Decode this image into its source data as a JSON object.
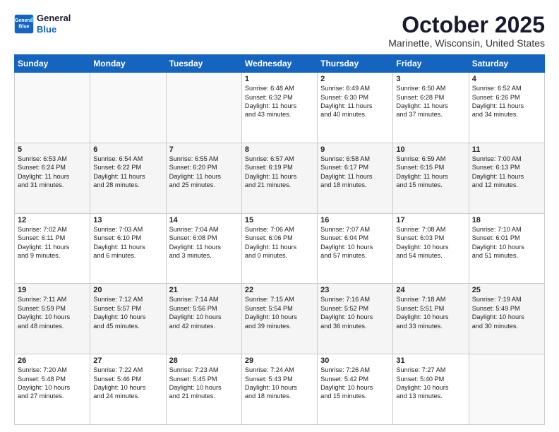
{
  "header": {
    "logo_line1": "General",
    "logo_line2": "Blue",
    "main_title": "October 2025",
    "subtitle": "Marinette, Wisconsin, United States"
  },
  "days_of_week": [
    "Sunday",
    "Monday",
    "Tuesday",
    "Wednesday",
    "Thursday",
    "Friday",
    "Saturday"
  ],
  "weeks": [
    [
      {
        "day": "",
        "info": ""
      },
      {
        "day": "",
        "info": ""
      },
      {
        "day": "",
        "info": ""
      },
      {
        "day": "1",
        "info": "Sunrise: 6:48 AM\nSunset: 6:32 PM\nDaylight: 11 hours\nand 43 minutes."
      },
      {
        "day": "2",
        "info": "Sunrise: 6:49 AM\nSunset: 6:30 PM\nDaylight: 11 hours\nand 40 minutes."
      },
      {
        "day": "3",
        "info": "Sunrise: 6:50 AM\nSunset: 6:28 PM\nDaylight: 11 hours\nand 37 minutes."
      },
      {
        "day": "4",
        "info": "Sunrise: 6:52 AM\nSunset: 6:26 PM\nDaylight: 11 hours\nand 34 minutes."
      }
    ],
    [
      {
        "day": "5",
        "info": "Sunrise: 6:53 AM\nSunset: 6:24 PM\nDaylight: 11 hours\nand 31 minutes."
      },
      {
        "day": "6",
        "info": "Sunrise: 6:54 AM\nSunset: 6:22 PM\nDaylight: 11 hours\nand 28 minutes."
      },
      {
        "day": "7",
        "info": "Sunrise: 6:55 AM\nSunset: 6:20 PM\nDaylight: 11 hours\nand 25 minutes."
      },
      {
        "day": "8",
        "info": "Sunrise: 6:57 AM\nSunset: 6:19 PM\nDaylight: 11 hours\nand 21 minutes."
      },
      {
        "day": "9",
        "info": "Sunrise: 6:58 AM\nSunset: 6:17 PM\nDaylight: 11 hours\nand 18 minutes."
      },
      {
        "day": "10",
        "info": "Sunrise: 6:59 AM\nSunset: 6:15 PM\nDaylight: 11 hours\nand 15 minutes."
      },
      {
        "day": "11",
        "info": "Sunrise: 7:00 AM\nSunset: 6:13 PM\nDaylight: 11 hours\nand 12 minutes."
      }
    ],
    [
      {
        "day": "12",
        "info": "Sunrise: 7:02 AM\nSunset: 6:11 PM\nDaylight: 11 hours\nand 9 minutes."
      },
      {
        "day": "13",
        "info": "Sunrise: 7:03 AM\nSunset: 6:10 PM\nDaylight: 11 hours\nand 6 minutes."
      },
      {
        "day": "14",
        "info": "Sunrise: 7:04 AM\nSunset: 6:08 PM\nDaylight: 11 hours\nand 3 minutes."
      },
      {
        "day": "15",
        "info": "Sunrise: 7:06 AM\nSunset: 6:06 PM\nDaylight: 11 hours\nand 0 minutes."
      },
      {
        "day": "16",
        "info": "Sunrise: 7:07 AM\nSunset: 6:04 PM\nDaylight: 10 hours\nand 57 minutes."
      },
      {
        "day": "17",
        "info": "Sunrise: 7:08 AM\nSunset: 6:03 PM\nDaylight: 10 hours\nand 54 minutes."
      },
      {
        "day": "18",
        "info": "Sunrise: 7:10 AM\nSunset: 6:01 PM\nDaylight: 10 hours\nand 51 minutes."
      }
    ],
    [
      {
        "day": "19",
        "info": "Sunrise: 7:11 AM\nSunset: 5:59 PM\nDaylight: 10 hours\nand 48 minutes."
      },
      {
        "day": "20",
        "info": "Sunrise: 7:12 AM\nSunset: 5:57 PM\nDaylight: 10 hours\nand 45 minutes."
      },
      {
        "day": "21",
        "info": "Sunrise: 7:14 AM\nSunset: 5:56 PM\nDaylight: 10 hours\nand 42 minutes."
      },
      {
        "day": "22",
        "info": "Sunrise: 7:15 AM\nSunset: 5:54 PM\nDaylight: 10 hours\nand 39 minutes."
      },
      {
        "day": "23",
        "info": "Sunrise: 7:16 AM\nSunset: 5:52 PM\nDaylight: 10 hours\nand 36 minutes."
      },
      {
        "day": "24",
        "info": "Sunrise: 7:18 AM\nSunset: 5:51 PM\nDaylight: 10 hours\nand 33 minutes."
      },
      {
        "day": "25",
        "info": "Sunrise: 7:19 AM\nSunset: 5:49 PM\nDaylight: 10 hours\nand 30 minutes."
      }
    ],
    [
      {
        "day": "26",
        "info": "Sunrise: 7:20 AM\nSunset: 5:48 PM\nDaylight: 10 hours\nand 27 minutes."
      },
      {
        "day": "27",
        "info": "Sunrise: 7:22 AM\nSunset: 5:46 PM\nDaylight: 10 hours\nand 24 minutes."
      },
      {
        "day": "28",
        "info": "Sunrise: 7:23 AM\nSunset: 5:45 PM\nDaylight: 10 hours\nand 21 minutes."
      },
      {
        "day": "29",
        "info": "Sunrise: 7:24 AM\nSunset: 5:43 PM\nDaylight: 10 hours\nand 18 minutes."
      },
      {
        "day": "30",
        "info": "Sunrise: 7:26 AM\nSunset: 5:42 PM\nDaylight: 10 hours\nand 15 minutes."
      },
      {
        "day": "31",
        "info": "Sunrise: 7:27 AM\nSunset: 5:40 PM\nDaylight: 10 hours\nand 13 minutes."
      },
      {
        "day": "",
        "info": ""
      }
    ]
  ]
}
